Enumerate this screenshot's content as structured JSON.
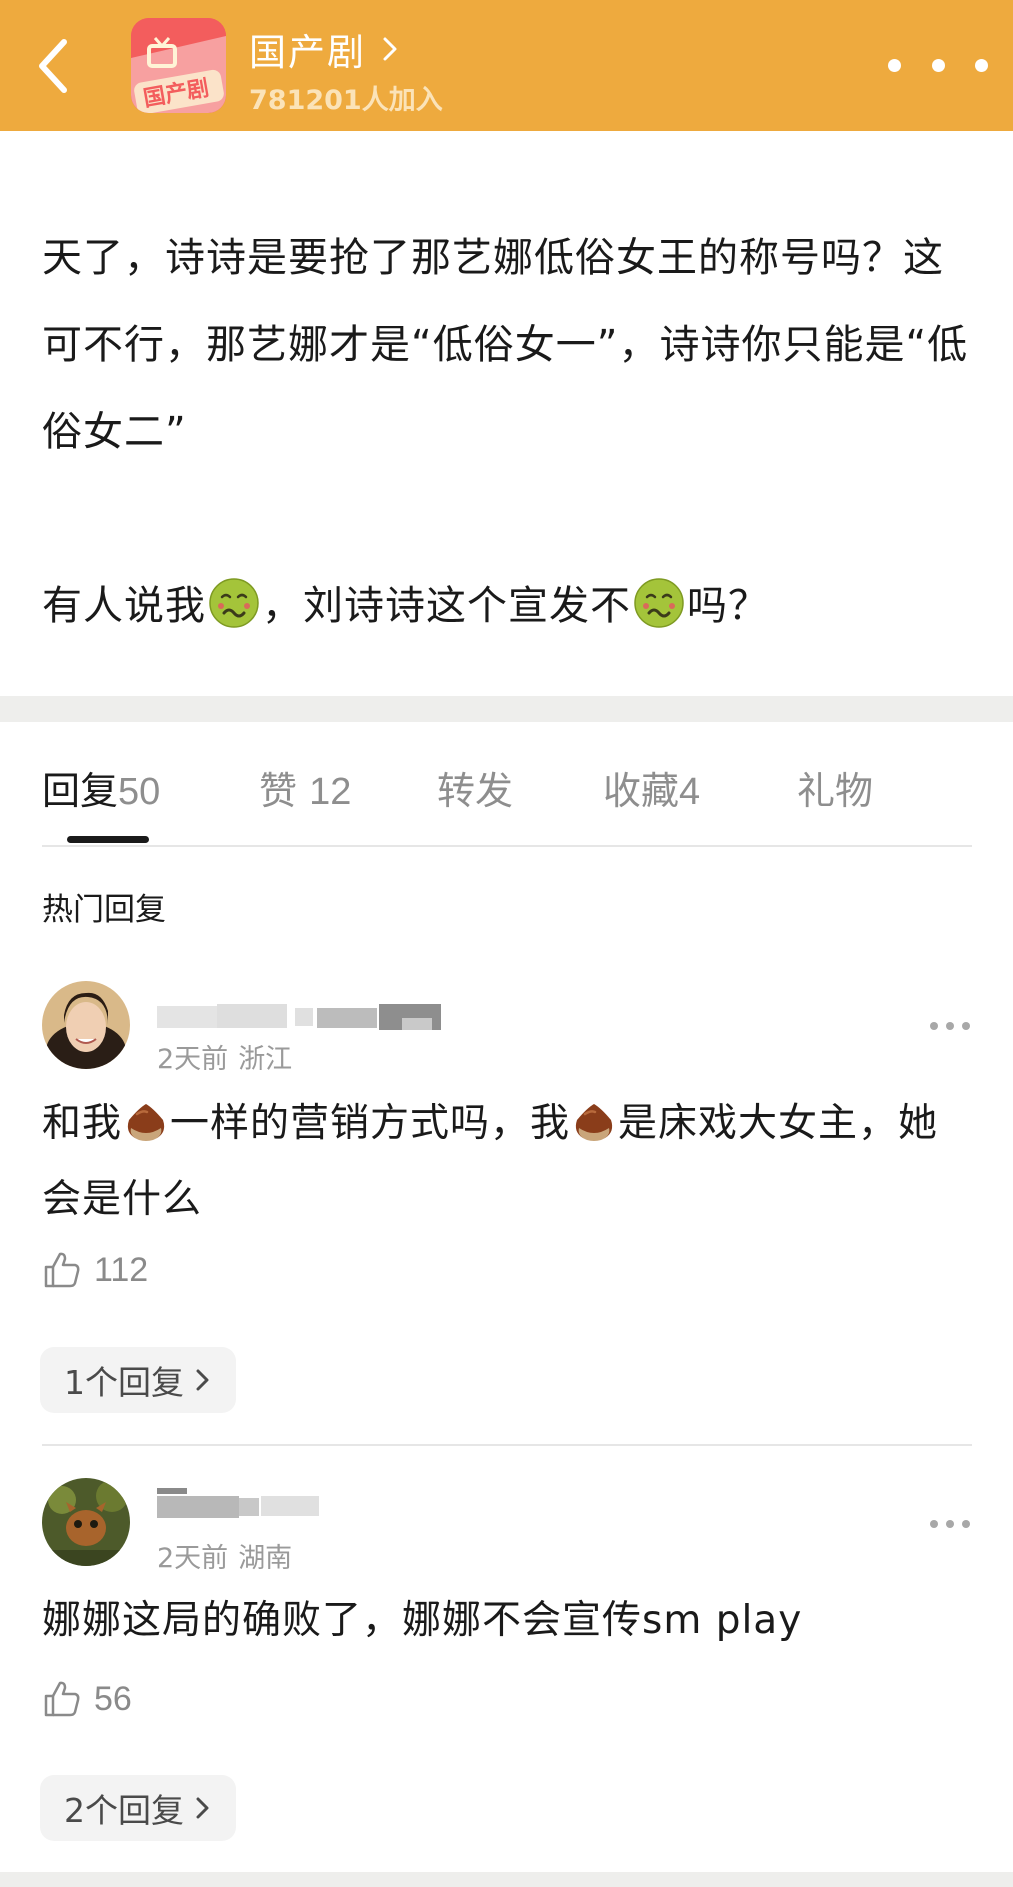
{
  "header": {
    "back_icon": "chevron-left-icon",
    "group_name": "国产剧",
    "group_avatar_text": "国产剧",
    "member_count": "781201人加入",
    "more_icon": "more-horizontal-icon",
    "bg_color": "#eeaa3e"
  },
  "post": {
    "paragraph1": "天了，诗诗是要抢了那艺娜低俗女王的称号吗？这可不行，那艺娜才是“低俗女一”，诗诗你只能是“低俗女二”",
    "paragraph2_parts": [
      "有人说我",
      "，刘诗诗这个宣发不",
      "吗？"
    ],
    "inline_emoji": "nauseated-face-emoji"
  },
  "tabs": [
    {
      "label": "回复",
      "count": "50"
    },
    {
      "label": "赞",
      "count": "12"
    },
    {
      "label": "转发",
      "count": ""
    },
    {
      "label": "收藏",
      "count": "4"
    },
    {
      "label": "礼物",
      "count": ""
    }
  ],
  "hot_replies_label": "热门回复",
  "comments": [
    {
      "time": "2天前",
      "location": "浙江",
      "text_parts": [
        "和我",
        "一样的营销方式吗，我",
        "是床戏大女主，她会是什么"
      ],
      "inline_emoji": "chestnut-emoji",
      "likes": "112",
      "replies_label": "1个回复"
    },
    {
      "time": "2天前",
      "location": "湖南",
      "text": "娜娜这局的确败了，娜娜不会宣传sm play",
      "likes": "56",
      "replies_label": "2个回复"
    }
  ]
}
